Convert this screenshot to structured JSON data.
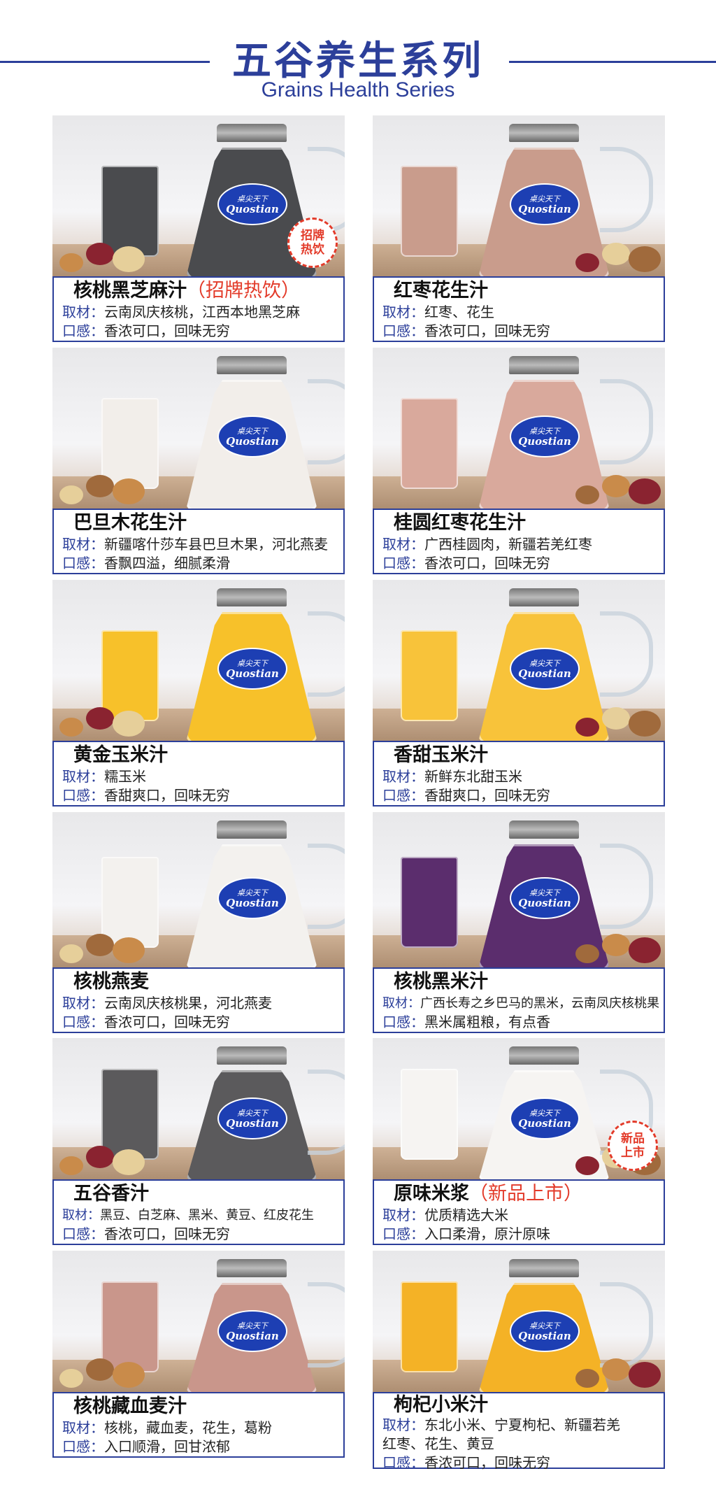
{
  "header": {
    "title": "五谷养生系列",
    "subtitle": "Grains Health Series"
  },
  "logo": {
    "line1": "桌尖天下",
    "line2": "Quostian"
  },
  "labels": {
    "ingredients": "取材",
    "taste": "口感"
  },
  "products": [
    {
      "name": "核桃黑芝麻汁",
      "tag": "（招牌热饮）",
      "badge": "招牌热饮",
      "ingredients": "云南凤庆核桃，江西本地黑芝麻",
      "taste": "香浓可口，回味无穷",
      "drink_color": "#4a4b4e"
    },
    {
      "name": "红枣花生汁",
      "tag": "",
      "badge": "",
      "ingredients": "红枣、花生",
      "taste": "香浓可口，回味无穷",
      "drink_color": "#c99c8c"
    },
    {
      "name": "巴旦木花生汁",
      "tag": "",
      "badge": "",
      "ingredients": "新疆喀什莎车县巴旦木果，河北燕麦",
      "taste": "香飘四溢，细腻柔滑",
      "drink_color": "#f2eeea"
    },
    {
      "name": "桂圆红枣花生汁",
      "tag": "",
      "badge": "",
      "ingredients": "广西桂圆肉，新疆若羌红枣",
      "taste": "香浓可口，回味无穷",
      "drink_color": "#d9a99c"
    },
    {
      "name": "黄金玉米汁",
      "tag": "",
      "badge": "",
      "ingredients": "糯玉米",
      "taste": "香甜爽口，回味无穷",
      "drink_color": "#f7c12a"
    },
    {
      "name": "香甜玉米汁",
      "tag": "",
      "badge": "",
      "ingredients": "新鲜东北甜玉米",
      "taste": "香甜爽口，回味无穷",
      "drink_color": "#f8c33a"
    },
    {
      "name": "核桃燕麦",
      "tag": "",
      "badge": "",
      "ingredients": "云南凤庆核桃果，河北燕麦",
      "taste": "香浓可口，回味无穷",
      "drink_color": "#f3f1ee"
    },
    {
      "name": "核桃黑米汁",
      "tag": "",
      "badge": "",
      "ingredients": "广西长寿之乡巴马的黑米，云南凤庆核桃果",
      "taste": "黑米属粗粮，有点香",
      "drink_color": "#5b2d6d"
    },
    {
      "name": "五谷香汁",
      "tag": "",
      "badge": "",
      "ingredients": "黑豆、白芝麻、黑米、黄豆、红皮花生",
      "taste": "香浓可口，回味无穷",
      "drink_color": "#5b5a5c"
    },
    {
      "name": "原味米浆",
      "tag": "（新品上市）",
      "badge": "新品上市",
      "ingredients": "优质精选大米",
      "taste": "入口柔滑，原汁原味",
      "drink_color": "#f6f4f2"
    },
    {
      "name": "核桃藏血麦汁",
      "tag": "",
      "badge": "",
      "ingredients": "核桃，藏血麦，花生，葛粉",
      "taste": "入口顺滑，回甘浓郁",
      "drink_color": "#c9968b"
    },
    {
      "name": "枸杞小米汁",
      "tag": "",
      "badge": "",
      "ingredients": "东北小米、宁夏枸杞、新疆若羌",
      "ingredients_cont": "红枣、花生、黄豆",
      "taste": "香浓可口，回味无穷",
      "drink_color": "#f4b226"
    }
  ],
  "colors": {
    "accent": "#2c3f9a",
    "highlight": "#e33b2a"
  }
}
